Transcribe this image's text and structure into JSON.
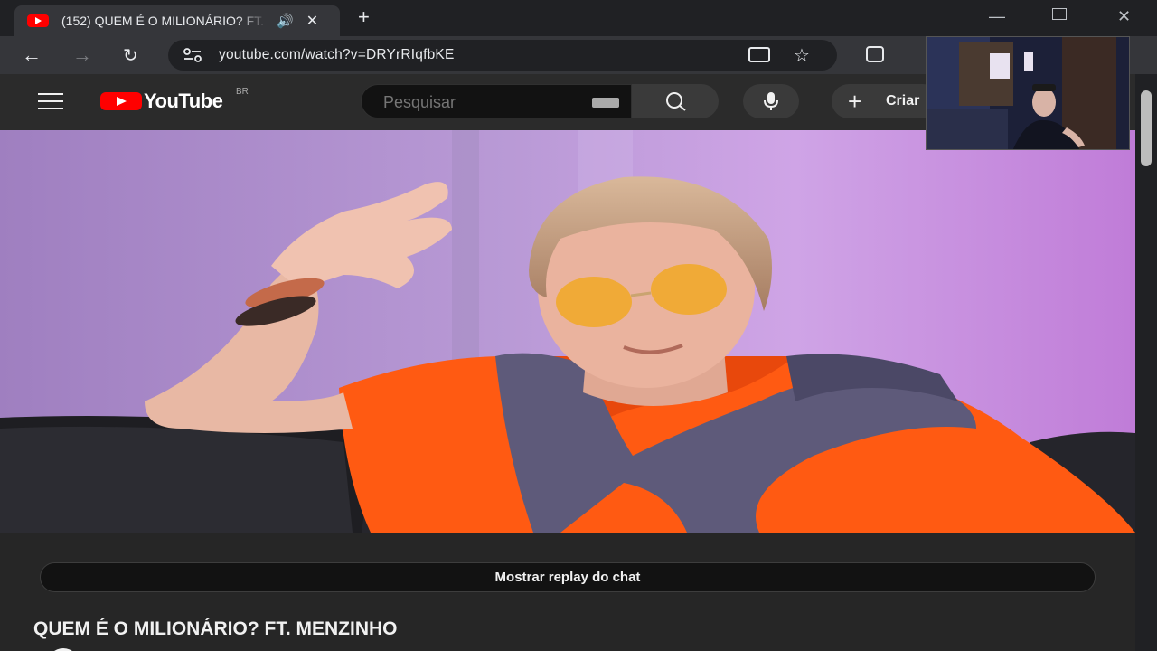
{
  "browser": {
    "tab": {
      "title": "(152) QUEM É O MILIONÁRIO? FT. MENZINHO"
    },
    "url": "youtube.com/watch?v=DRYrRIqfbKE"
  },
  "youtube": {
    "logo_text": "YouTube",
    "country": "BR",
    "search_placeholder": "Pesquisar",
    "create_label": "Criar"
  },
  "video": {
    "chat_replay_label": "Mostrar replay do chat",
    "title": "QUEM É O MILIONÁRIO? FT. MENZINHO"
  },
  "colors": {
    "brand_red": "#ff0000",
    "shirt_orange": "#ff5a12",
    "background_purple": "#b58ed3"
  }
}
